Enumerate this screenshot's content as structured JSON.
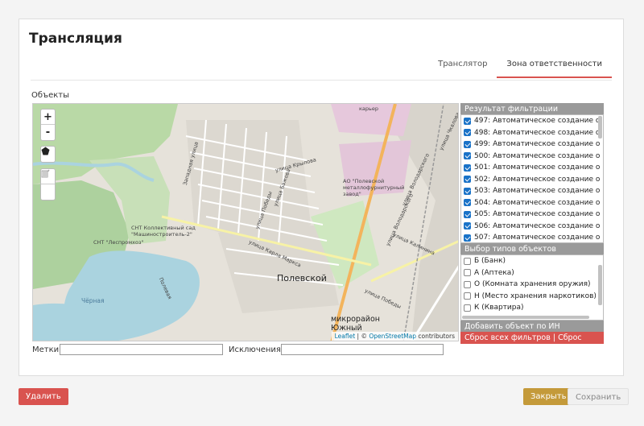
{
  "page": {
    "title": "Трансляция",
    "tabs": [
      {
        "label": "Транслятор",
        "active": false
      },
      {
        "label": "Зона ответственности",
        "active": true
      }
    ],
    "objects_label": "Объекты"
  },
  "map": {
    "city_label": "Полевской",
    "district_label": "микрорайон Южный",
    "labels": {
      "factory": "АО \"Полевской металлофурнитурный завод\"",
      "korer": "карьер",
      "snt1": "СНТ Коллективный сад \"Машиностроитель-2\"",
      "snt2": "СНТ \"Леспромхоз\"",
      "river": "Чёрная",
      "st1": "улица Крылова",
      "st2": "улица Бажова",
      "st3": "улица Победы",
      "st4": "улица Карла Маркса",
      "st5": "улица Володарского",
      "st6": "улица Калинина",
      "st7": "улица Победы",
      "st8": "Западная улица",
      "st9": "улица Чкалова",
      "st10": "Полевая"
    },
    "controls": {
      "zoom_in": "+",
      "zoom_out": "-"
    },
    "attribution": {
      "leaflet": "Leaflet",
      "sep": " | © ",
      "osm": "OpenStreetMap",
      "contrib": " contributors"
    }
  },
  "filter_results": {
    "header": "Результат фильтрации",
    "items": [
      {
        "label": "497: Автоматическое создание о",
        "checked": true
      },
      {
        "label": "498: Автоматическое создание о",
        "checked": true
      },
      {
        "label": "499: Автоматическое создание о",
        "checked": true
      },
      {
        "label": "500: Автоматическое создание о",
        "checked": true
      },
      {
        "label": "501: Автоматическое создание о",
        "checked": true
      },
      {
        "label": "502: Автоматическое создание о",
        "checked": true
      },
      {
        "label": "503: Автоматическое создание о",
        "checked": true
      },
      {
        "label": "504: Автоматическое создание о",
        "checked": true
      },
      {
        "label": "505: Автоматическое создание о",
        "checked": true
      },
      {
        "label": "506: Автоматическое создание о",
        "checked": true
      },
      {
        "label": "507: Автоматическое создание о",
        "checked": true
      }
    ]
  },
  "object_types": {
    "header": "Выбор типов объектов",
    "items": [
      {
        "label": "Б (Банк)",
        "checked": false
      },
      {
        "label": "А (Аптека)",
        "checked": false
      },
      {
        "label": "О (Комната хранения оружия)",
        "checked": false
      },
      {
        "label": "Н (Место хранения наркотиков)",
        "checked": false
      },
      {
        "label": "К (Квартира)",
        "checked": false
      }
    ]
  },
  "add_by_in": "Добавить объект по ИН",
  "reset_filters": "Сброс всех фильтров | Сброс",
  "filters": {
    "tags_label": "Метки:",
    "tags_value": "",
    "exclusions_label": "Исключения:",
    "exclusions_value": ""
  },
  "buttons": {
    "delete": "Удалить",
    "close": "Закрыть",
    "save": "Сохранить"
  },
  "colors": {
    "accent_red": "#d9534f",
    "close_gold": "#c49a3a",
    "checkbox_blue": "#1a73c8"
  }
}
